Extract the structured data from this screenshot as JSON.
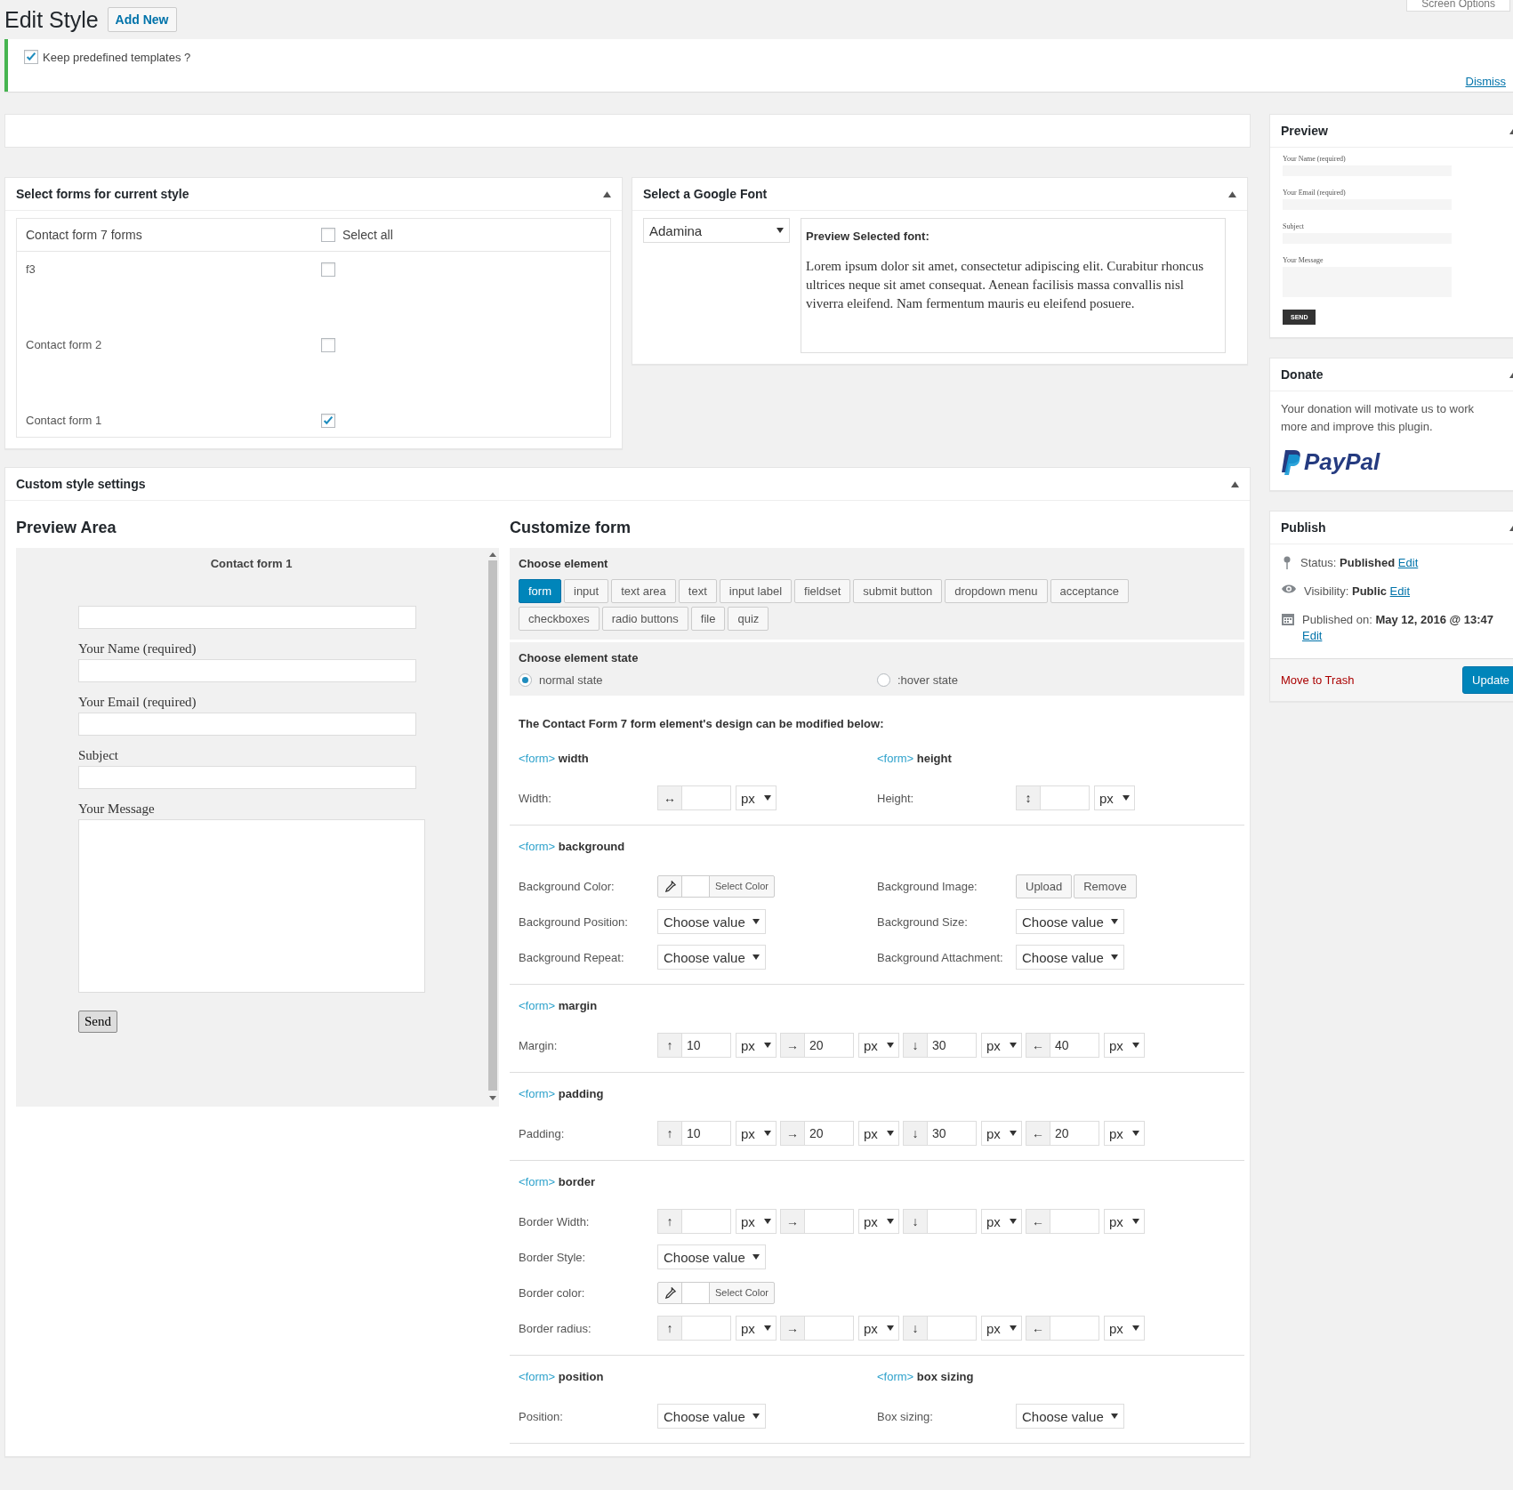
{
  "header": {
    "title": "Edit Style",
    "add_new": "Add New",
    "screen_options": "Screen Options"
  },
  "notice": {
    "label": "Keep predefined templates ?",
    "checked": true,
    "dismiss": "Dismiss"
  },
  "forms_box": {
    "title": "Select forms for current style",
    "column": "Contact form 7 forms",
    "select_all": {
      "label": "Select all",
      "checked": false
    },
    "forms": [
      {
        "name": "f3",
        "checked": false
      },
      {
        "name": "Contact form 2",
        "checked": false
      },
      {
        "name": "Contact form 1",
        "checked": true
      }
    ]
  },
  "font_box": {
    "title": "Select a Google Font",
    "font": "Adamina",
    "preview_label": "Preview Selected font:",
    "preview_text": "Lorem ipsum dolor sit amet, consectetur adipiscing elit. Curabitur rhoncus ultrices neque sit amet consequat. Aenean facilisis massa convallis nisl viverra eleifend. Nam fermentum mauris eu eleifend posuere."
  },
  "custom": {
    "title": "Custom style settings",
    "preview_area": {
      "heading": "Preview Area",
      "form_title": "Contact form 1",
      "items": [
        {
          "kind": "input"
        },
        {
          "kind": "label",
          "text": "Your Name (required)"
        },
        {
          "kind": "input"
        },
        {
          "kind": "label",
          "text": "Your Email (required)"
        },
        {
          "kind": "input"
        },
        {
          "kind": "label",
          "text": "Subject"
        },
        {
          "kind": "input"
        },
        {
          "kind": "label",
          "text": "Your Message"
        },
        {
          "kind": "textarea"
        },
        {
          "kind": "button",
          "text": "Send"
        }
      ]
    },
    "customize": {
      "heading": "Customize form",
      "choose_element": "Choose element",
      "elements": [
        {
          "label": "form",
          "selected": true
        },
        {
          "label": "input",
          "selected": false
        },
        {
          "label": "text area",
          "selected": false
        },
        {
          "label": "text",
          "selected": false
        },
        {
          "label": "input label",
          "selected": false
        },
        {
          "label": "fieldset",
          "selected": false
        },
        {
          "label": "submit button",
          "selected": false
        },
        {
          "label": "dropdown menu",
          "selected": false
        },
        {
          "label": "acceptance",
          "selected": false
        },
        {
          "label": "checkboxes",
          "selected": false
        },
        {
          "label": "radio buttons",
          "selected": false
        },
        {
          "label": "file",
          "selected": false
        },
        {
          "label": "quiz",
          "selected": false
        }
      ],
      "choose_state": "Choose element state",
      "states": [
        {
          "label": "normal state",
          "selected": true
        },
        {
          "label": ":hover state",
          "selected": false
        }
      ],
      "intro": "The Contact Form 7 form element's design can be modified below:",
      "sections": [
        {
          "columns": [
            {
              "tag": "<form>",
              "name": "width",
              "rows": [
                {
                  "kind": "units",
                  "label": "Width:",
                  "inputs": [
                    {
                      "icon": "↔",
                      "unit": "px"
                    }
                  ]
                }
              ]
            },
            {
              "tag": "<form>",
              "name": "height",
              "rows": [
                {
                  "kind": "units",
                  "label": "Height:",
                  "inputs": [
                    {
                      "icon": "↕",
                      "unit": "px"
                    }
                  ]
                }
              ]
            }
          ]
        },
        {
          "tag": "<form>",
          "name": "background",
          "columns": [
            {
              "rows": [
                {
                  "kind": "color",
                  "label": "Background Color:",
                  "button": "Select Color"
                },
                {
                  "kind": "select",
                  "label": "Background Position:",
                  "value": "Choose value"
                },
                {
                  "kind": "select",
                  "label": "Background Repeat:",
                  "value": "Choose value"
                }
              ]
            },
            {
              "rows": [
                {
                  "kind": "buttons",
                  "label": "Background Image:",
                  "buttons": [
                    "Upload",
                    "Remove"
                  ]
                },
                {
                  "kind": "select",
                  "label": "Background Size:",
                  "value": "Choose value"
                },
                {
                  "kind": "select",
                  "label": "Background Attachment:",
                  "value": "Choose value"
                }
              ]
            }
          ]
        },
        {
          "tag": "<form>",
          "name": "margin",
          "columns": [
            {
              "rows": [
                {
                  "kind": "units",
                  "label": "Margin:",
                  "inputs": [
                    {
                      "icon": "↑",
                      "value": "10",
                      "unit": "px"
                    },
                    {
                      "icon": "→",
                      "value": "20",
                      "unit": "px"
                    },
                    {
                      "icon": "↓",
                      "value": "30",
                      "unit": "px"
                    },
                    {
                      "icon": "←",
                      "value": "40",
                      "unit": "px"
                    }
                  ]
                }
              ]
            }
          ]
        },
        {
          "tag": "<form>",
          "name": "padding",
          "columns": [
            {
              "rows": [
                {
                  "kind": "units",
                  "label": "Padding:",
                  "inputs": [
                    {
                      "icon": "↑",
                      "value": "10",
                      "unit": "px"
                    },
                    {
                      "icon": "→",
                      "value": "20",
                      "unit": "px"
                    },
                    {
                      "icon": "↓",
                      "value": "30",
                      "unit": "px"
                    },
                    {
                      "icon": "←",
                      "value": "20",
                      "unit": "px"
                    }
                  ]
                }
              ]
            }
          ]
        },
        {
          "tag": "<form>",
          "name": "border",
          "columns": [
            {
              "rows": [
                {
                  "kind": "units",
                  "label": "Border Width:",
                  "inputs": [
                    {
                      "icon": "↑",
                      "unit": "px"
                    },
                    {
                      "icon": "→",
                      "unit": "px"
                    },
                    {
                      "icon": "↓",
                      "unit": "px"
                    },
                    {
                      "icon": "←",
                      "unit": "px"
                    }
                  ]
                },
                {
                  "kind": "select",
                  "label": "Border Style:",
                  "value": "Choose value"
                },
                {
                  "kind": "color",
                  "label": "Border color:",
                  "button": "Select Color"
                },
                {
                  "kind": "units",
                  "label": "Border radius:",
                  "inputs": [
                    {
                      "icon": "↑",
                      "unit": "px"
                    },
                    {
                      "icon": "→",
                      "unit": "px"
                    },
                    {
                      "icon": "↓",
                      "unit": "px"
                    },
                    {
                      "icon": "←",
                      "unit": "px"
                    }
                  ]
                }
              ]
            }
          ]
        },
        {
          "columns": [
            {
              "tag": "<form>",
              "name": "position",
              "rows": [
                {
                  "kind": "select",
                  "label": "Position:",
                  "value": "Choose value"
                }
              ]
            },
            {
              "tag": "<form>",
              "name": "box sizing",
              "rows": [
                {
                  "kind": "select",
                  "label": "Box sizing:",
                  "value": "Choose value"
                }
              ]
            }
          ]
        }
      ]
    }
  },
  "sidebar": {
    "preview": {
      "title": "Preview",
      "fields": [
        {
          "label": "Your Name (required)",
          "kind": "input"
        },
        {
          "label": "Your Email (required)",
          "kind": "input"
        },
        {
          "label": "Subject",
          "kind": "input"
        },
        {
          "label": "Your Message",
          "kind": "textarea"
        }
      ],
      "button": "SEND"
    },
    "donate": {
      "title": "Donate",
      "text": "Your donation will motivate us to work more and improve this plugin.",
      "logo": "PayPal"
    },
    "publish": {
      "title": "Publish",
      "rows": [
        {
          "kind": "status",
          "label": "Status:",
          "value": "Published",
          "link": "Edit"
        },
        {
          "kind": "visibility",
          "label": "Visibility:",
          "value": "Public",
          "link": "Edit"
        },
        {
          "kind": "date",
          "label": "Published on:",
          "value": "May 12, 2016 @ 13:47",
          "link": "Edit"
        }
      ],
      "trash": "Move to Trash",
      "update": "Update"
    }
  }
}
